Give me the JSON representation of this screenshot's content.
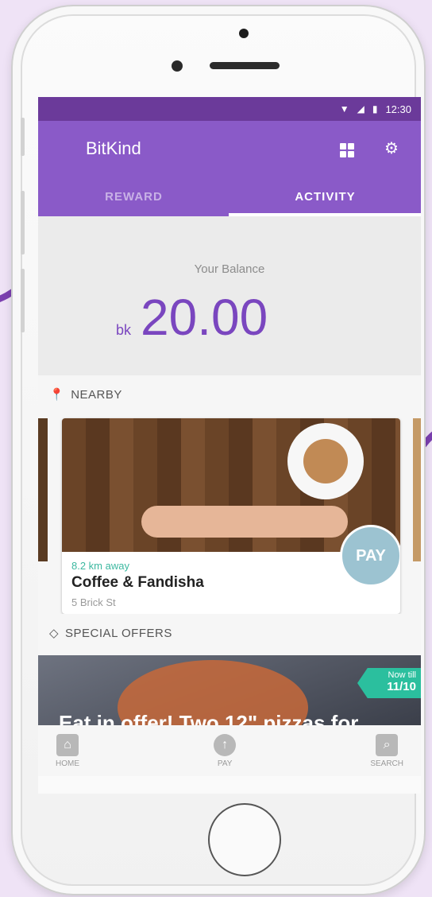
{
  "status_bar": {
    "time": "12:30",
    "wifi_icon": "wifi-icon",
    "signal_icon": "signal-icon",
    "battery_icon": "battery-icon"
  },
  "app_bar": {
    "title": "BitKind",
    "grid_icon": "grid-icon",
    "settings_icon": "gear-icon"
  },
  "tabs": [
    {
      "label": "REWARD",
      "active": false
    },
    {
      "label": "ACTIVITY",
      "active": true
    }
  ],
  "balance": {
    "label": "Your Balance",
    "currency": "bk",
    "amount": "20.00"
  },
  "nearby": {
    "heading": "NEARBY",
    "card": {
      "distance": "8.2 km away",
      "name": "Coffee & Fandisha",
      "address": "5 Brick St",
      "pay_label": "PAY"
    }
  },
  "offers": {
    "heading": "SPECIAL OFFERS",
    "banner": {
      "title": "Eat in offer! Two 12\" pizzas for",
      "badge_line1": "Now till",
      "badge_line2": "11/10"
    }
  },
  "bottom_nav": [
    {
      "label": "HOME",
      "icon": "store-icon"
    },
    {
      "label": "PAY",
      "icon": "arrow-up-icon"
    },
    {
      "label": "SEARCH",
      "icon": "search-icon"
    }
  ],
  "colors": {
    "primary": "#8a5ac8",
    "status_bar": "#6b3a9a",
    "accent_teal": "#2bbf9e",
    "balance_text": "#7a46bf"
  }
}
